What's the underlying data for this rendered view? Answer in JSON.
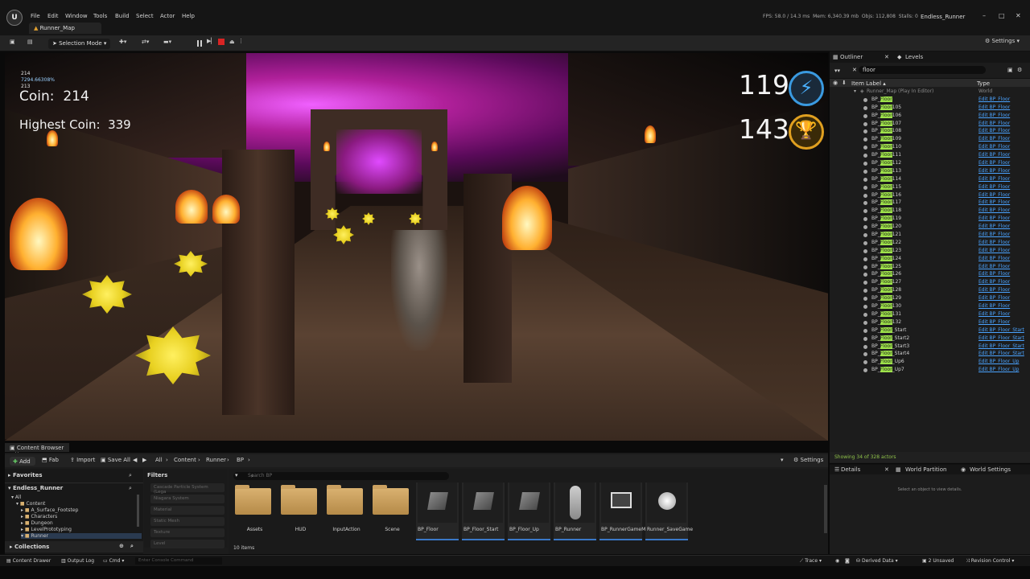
{
  "app": {
    "logo": "U",
    "menu": [
      "File",
      "Edit",
      "Window",
      "Tools",
      "Build",
      "Select",
      "Actor",
      "Help"
    ],
    "tab": "Runner_Map",
    "stats": {
      "fps": "FPS: 58.0",
      "ms": "14.3 ms",
      "mem": "Mem: 6,340.39 mb",
      "objs": "Objs: 112,808",
      "stalls": "Stalls: 0"
    },
    "project": "Endless_Runner"
  },
  "toolbar": {
    "selection_mode": "Selection Mode",
    "settings": "Settings"
  },
  "hud": {
    "debug": [
      "214",
      "7294.66308%",
      "213",
      "214"
    ],
    "coin_label": "Coin:",
    "coin_value": "214",
    "highest_label": "Highest Coin:",
    "highest_value": "339",
    "energy": "119",
    "trophy": "143"
  },
  "outliner": {
    "tabs": [
      "Outliner",
      "Levels"
    ],
    "search_value": "floor",
    "col_label": "Item Label",
    "col_type": "Type",
    "root": {
      "label": "Runner_Map (Play In Editor)",
      "type": "World"
    },
    "rows": [
      {
        "pre": "BP_",
        "hl": "Floor",
        "post": "",
        "type": "Edit BP_Floor"
      },
      {
        "pre": "BP_",
        "hl": "Floor",
        "post": "105",
        "type": "Edit BP_Floor"
      },
      {
        "pre": "BP_",
        "hl": "Floor",
        "post": "106",
        "type": "Edit BP_Floor"
      },
      {
        "pre": "BP_",
        "hl": "Floor",
        "post": "107",
        "type": "Edit BP_Floor"
      },
      {
        "pre": "BP_",
        "hl": "Floor",
        "post": "108",
        "type": "Edit BP_Floor"
      },
      {
        "pre": "BP_",
        "hl": "Floor",
        "post": "109",
        "type": "Edit BP_Floor"
      },
      {
        "pre": "BP_",
        "hl": "Floor",
        "post": "110",
        "type": "Edit BP_Floor"
      },
      {
        "pre": "BP_",
        "hl": "Floor",
        "post": "111",
        "type": "Edit BP_Floor"
      },
      {
        "pre": "BP_",
        "hl": "Floor",
        "post": "112",
        "type": "Edit BP_Floor"
      },
      {
        "pre": "BP_",
        "hl": "Floor",
        "post": "113",
        "type": "Edit BP_Floor"
      },
      {
        "pre": "BP_",
        "hl": "Floor",
        "post": "114",
        "type": "Edit BP_Floor"
      },
      {
        "pre": "BP_",
        "hl": "Floor",
        "post": "115",
        "type": "Edit BP_Floor"
      },
      {
        "pre": "BP_",
        "hl": "Floor",
        "post": "116",
        "type": "Edit BP_Floor"
      },
      {
        "pre": "BP_",
        "hl": "Floor",
        "post": "117",
        "type": "Edit BP_Floor"
      },
      {
        "pre": "BP_",
        "hl": "Floor",
        "post": "118",
        "type": "Edit BP_Floor"
      },
      {
        "pre": "BP_",
        "hl": "Floor",
        "post": "119",
        "type": "Edit BP_Floor"
      },
      {
        "pre": "BP_",
        "hl": "Floor",
        "post": "120",
        "type": "Edit BP_Floor"
      },
      {
        "pre": "BP_",
        "hl": "Floor",
        "post": "121",
        "type": "Edit BP_Floor"
      },
      {
        "pre": "BP_",
        "hl": "Floor",
        "post": "122",
        "type": "Edit BP_Floor"
      },
      {
        "pre": "BP_",
        "hl": "Floor",
        "post": "123",
        "type": "Edit BP_Floor"
      },
      {
        "pre": "BP_",
        "hl": "Floor",
        "post": "124",
        "type": "Edit BP_Floor"
      },
      {
        "pre": "BP_",
        "hl": "Floor",
        "post": "125",
        "type": "Edit BP_Floor"
      },
      {
        "pre": "BP_",
        "hl": "Floor",
        "post": "126",
        "type": "Edit BP_Floor"
      },
      {
        "pre": "BP_",
        "hl": "Floor",
        "post": "127",
        "type": "Edit BP_Floor"
      },
      {
        "pre": "BP_",
        "hl": "Floor",
        "post": "128",
        "type": "Edit BP_Floor"
      },
      {
        "pre": "BP_",
        "hl": "Floor",
        "post": "129",
        "type": "Edit BP_Floor"
      },
      {
        "pre": "BP_",
        "hl": "Floor",
        "post": "130",
        "type": "Edit BP_Floor"
      },
      {
        "pre": "BP_",
        "hl": "Floor",
        "post": "131",
        "type": "Edit BP_Floor"
      },
      {
        "pre": "BP_",
        "hl": "Floor",
        "post": "132",
        "type": "Edit BP_Floor"
      },
      {
        "pre": "BP_",
        "hl": "Floor",
        "post": "_Start",
        "type": "Edit BP_Floor_Start"
      },
      {
        "pre": "BP_",
        "hl": "Floor",
        "post": "_Start2",
        "type": "Edit BP_Floor_Start"
      },
      {
        "pre": "BP_",
        "hl": "Floor",
        "post": "_Start3",
        "type": "Edit BP_Floor_Start"
      },
      {
        "pre": "BP_",
        "hl": "Floor",
        "post": "_Start4",
        "type": "Edit BP_Floor_Start"
      },
      {
        "pre": "BP_",
        "hl": "Floor",
        "post": "_Up6",
        "type": "Edit BP_Floor_Up"
      },
      {
        "pre": "BP_",
        "hl": "Floor",
        "post": "_Up7",
        "type": "Edit BP_Floor_Up"
      }
    ],
    "status": "Showing 34 of 328 actors"
  },
  "details": {
    "tabs": [
      "Details",
      "World Partition",
      "World Settings"
    ],
    "empty": "Select an object to view details."
  },
  "content_browser": {
    "tab": "Content Browser",
    "buttons": {
      "add": "Add",
      "fab": "Fab",
      "import": "Import",
      "save_all": "Save All",
      "settings": "Settings"
    },
    "breadcrumb": [
      "All",
      "Content",
      "Runner",
      "BP"
    ],
    "favorites": "Favorites",
    "project": "Endless_Runner",
    "tree": [
      "All",
      "Content",
      "A_Surface_Footstep",
      "Characters",
      "Dungeon",
      "LevelPrototyping",
      "Runner"
    ],
    "filters_title": "Filters",
    "filters": [
      "Cascade Particle System (Lega",
      "Niagara System",
      "Material",
      "Static Mesh",
      "Texture",
      "Level"
    ],
    "search_placeholder": "Search BP",
    "folders": [
      "Assets",
      "HUD",
      "InputAction",
      "Scene"
    ],
    "blueprints": [
      "BP_Floor",
      "BP_Floor_Start",
      "BP_Floor_Up",
      "BP_Runner",
      "BP_RunnerGameMode",
      "Runner_SaveGame"
    ],
    "count": "10 items",
    "collections": "Collections"
  },
  "statusbar": {
    "content_drawer": "Content Drawer",
    "output_log": "Output Log",
    "cmd": "Cmd",
    "console_placeholder": "Enter Console Command",
    "trace": "Trace",
    "derived": "Derived Data",
    "unsaved": "2 Unsaved",
    "revision": "Revision Control"
  }
}
